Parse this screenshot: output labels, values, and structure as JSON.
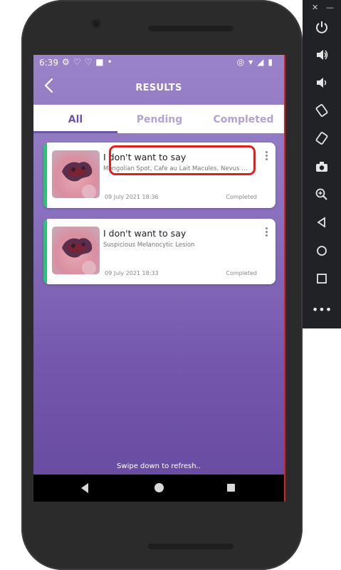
{
  "status_bar": {
    "time": "6:39",
    "left_icons": [
      "gear-icon",
      "heart-outline-icon",
      "heart-outline-icon",
      "square-icon",
      "dot-icon"
    ],
    "right_icons": [
      "location-icon",
      "wifi-icon",
      "signal-icon",
      "battery-icon"
    ]
  },
  "app_bar": {
    "title": "RESULTS",
    "back_icon": "chevron-left-icon"
  },
  "tabs": [
    {
      "label": "All",
      "active": true
    },
    {
      "label": "Pending",
      "active": false
    },
    {
      "label": "Completed",
      "active": false
    }
  ],
  "results": [
    {
      "title": "I don't want to say",
      "subtitle": "Mongolian Spot, Cafe au Lait Macules, Nevus of...",
      "date": "09 July 2021 18:36",
      "status": "Completed",
      "accent_color": "#29c471",
      "highlighted": true
    },
    {
      "title": "I don't want to say",
      "subtitle": "Suspicious Melanocytic Lesion",
      "date": "09 July 2021 18:33",
      "status": "Completed",
      "accent_color": "#29c471",
      "highlighted": false
    }
  ],
  "footer": {
    "refresh_hint": "Swipe down to refresh.."
  },
  "nav_bar": {
    "icons": [
      "back-triangle-icon",
      "home-circle-icon",
      "recents-square-icon"
    ]
  },
  "emulator_toolbar": {
    "window_controls": [
      "close-icon",
      "minimize-icon"
    ],
    "icons": [
      "power-icon",
      "volume-up-icon",
      "volume-down-icon",
      "rotate-left-icon",
      "rotate-right-icon",
      "camera-icon",
      "zoom-icon",
      "back-icon",
      "home-icon",
      "overview-icon",
      "more-icon"
    ]
  },
  "colors": {
    "header_purple": "#9b83c8",
    "tab_active": "#6e56a6",
    "tab_inactive": "#b3a2d6",
    "accent_green": "#29c471",
    "highlight_red": "#e02020"
  }
}
